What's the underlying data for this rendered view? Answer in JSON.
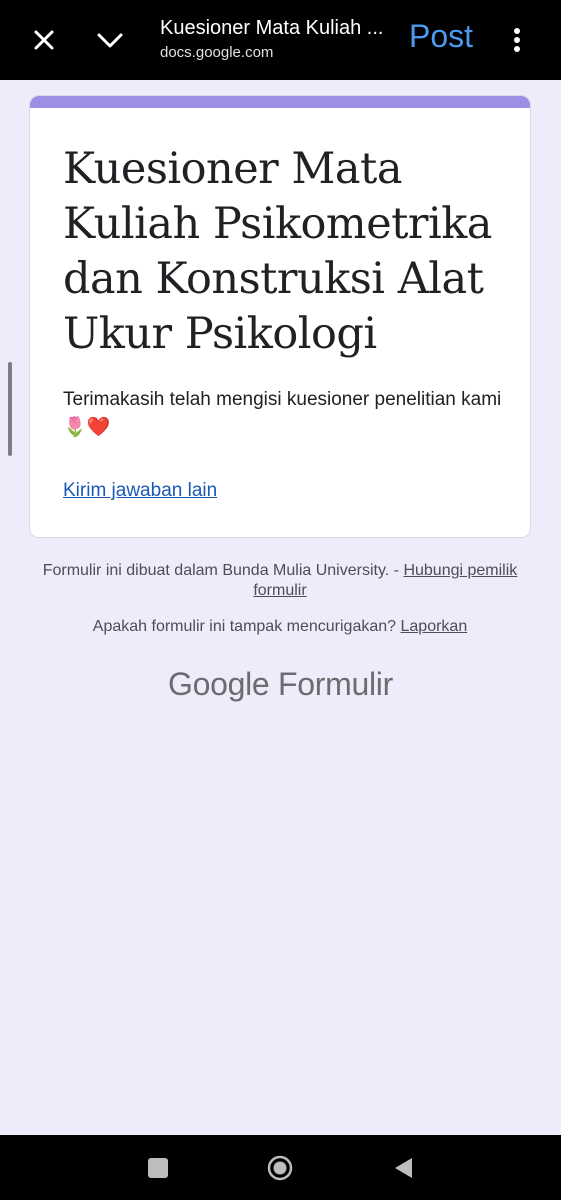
{
  "browser": {
    "title": "Kuesioner Mata Kuliah ...",
    "url": "docs.google.com",
    "post_label": "Post",
    "icons": {
      "close": "close-icon",
      "collapse": "chevron-down-icon",
      "menu": "more-vert-icon"
    }
  },
  "form": {
    "title": "Kuesioner Mata Kuliah Psikometrika dan Konstruksi Alat Ukur Psikologi",
    "confirmation": "Terimakasih telah mengisi kuesioner penelitian kami 🌷❤️",
    "resend_link": "Kirim jawaban lain"
  },
  "footer": {
    "made_in": "Formulir ini dibuat dalam Bunda Mulia University. -",
    "contact_link": "Hubungi pemilik formulir",
    "suspicious": "Apakah formulir ini tampak mencurigakan?",
    "report_link": "Laporkan",
    "brand_google": "Google",
    "brand_forms": "Formulir"
  },
  "colors": {
    "accent": "#9c8fe6",
    "page_background": "#efebfa",
    "link": "#1a59b5",
    "post_button": "#4a9af0"
  }
}
